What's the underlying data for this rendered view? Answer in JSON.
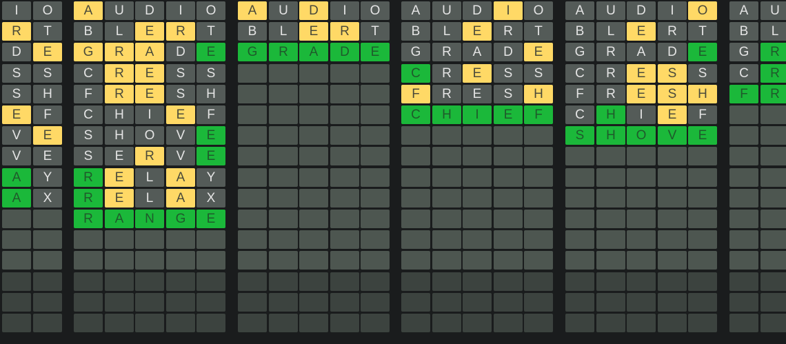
{
  "colors": {
    "background": "#1a1c1d",
    "absent": "#545b58",
    "present": "#ffd966",
    "correct": "#1bb83a",
    "empty": "#4d5650",
    "empty_dim": "#3c433f"
  },
  "total_rows": 16,
  "boards": [
    {
      "id": "board-partial-left",
      "rows": [
        [
          "I:a",
          "O:a"
        ],
        [
          "R:p",
          "T:a"
        ],
        [
          "D:a",
          "E:p"
        ],
        [
          "S:a",
          "S:a"
        ],
        [
          "S:a",
          "H:a"
        ],
        [
          "E:p",
          "F:a"
        ],
        [
          "V:a",
          "E:p"
        ],
        [
          "V:a",
          "E:a"
        ],
        [
          "A:c",
          "Y:a"
        ],
        [
          "A:c",
          "X:a"
        ]
      ]
    },
    {
      "id": "board-1",
      "rows": [
        [
          "A:p",
          "U:a",
          "D:a",
          "I:a",
          "O:a"
        ],
        [
          "B:a",
          "L:a",
          "E:p",
          "R:p",
          "T:a"
        ],
        [
          "G:p",
          "R:p",
          "A:p",
          "D:a",
          "E:c"
        ],
        [
          "C:a",
          "R:p",
          "E:p",
          "S:a",
          "S:a"
        ],
        [
          "F:a",
          "R:p",
          "E:p",
          "S:a",
          "H:a"
        ],
        [
          "C:a",
          "H:a",
          "I:a",
          "E:p",
          "F:a"
        ],
        [
          "S:a",
          "H:a",
          "O:a",
          "V:a",
          "E:c"
        ],
        [
          "S:a",
          "E:a",
          "R:p",
          "V:a",
          "E:c"
        ],
        [
          "R:c",
          "E:p",
          "L:a",
          "A:p",
          "Y:a"
        ],
        [
          "R:c",
          "E:p",
          "L:a",
          "A:p",
          "X:a"
        ],
        [
          "R:c",
          "A:c",
          "N:c",
          "G:c",
          "E:c"
        ]
      ]
    },
    {
      "id": "board-2",
      "rows": [
        [
          "A:p",
          "U:a",
          "D:p",
          "I:a",
          "O:a"
        ],
        [
          "B:a",
          "L:a",
          "E:p",
          "R:p",
          "T:a"
        ],
        [
          "G:c",
          "R:c",
          "A:c",
          "D:c",
          "E:c"
        ]
      ]
    },
    {
      "id": "board-3",
      "rows": [
        [
          "A:a",
          "U:a",
          "D:a",
          "I:p",
          "O:a"
        ],
        [
          "B:a",
          "L:a",
          "E:p",
          "R:a",
          "T:a"
        ],
        [
          "G:a",
          "R:a",
          "A:a",
          "D:a",
          "E:p"
        ],
        [
          "C:c",
          "R:a",
          "E:p",
          "S:a",
          "S:a"
        ],
        [
          "F:p",
          "R:a",
          "E:a",
          "S:a",
          "H:p"
        ],
        [
          "C:c",
          "H:c",
          "I:c",
          "E:c",
          "F:c"
        ]
      ]
    },
    {
      "id": "board-4",
      "rows": [
        [
          "A:a",
          "U:a",
          "D:a",
          "I:a",
          "O:p"
        ],
        [
          "B:a",
          "L:a",
          "E:p",
          "R:a",
          "T:a"
        ],
        [
          "G:a",
          "R:a",
          "A:a",
          "D:a",
          "E:c"
        ],
        [
          "C:a",
          "R:a",
          "E:p",
          "S:p",
          "S:a"
        ],
        [
          "F:a",
          "R:a",
          "E:p",
          "S:p",
          "H:p"
        ],
        [
          "C:a",
          "H:c",
          "I:a",
          "E:p",
          "F:a"
        ],
        [
          "S:c",
          "H:c",
          "O:c",
          "V:c",
          "E:c"
        ]
      ]
    },
    {
      "id": "board-partial-right",
      "rows": [
        [
          "A:a",
          "U:a"
        ],
        [
          "B:a",
          "L:a"
        ],
        [
          "G:a",
          "R:c"
        ],
        [
          "C:a",
          "R:c"
        ],
        [
          "F:c",
          "R:c"
        ]
      ]
    }
  ]
}
